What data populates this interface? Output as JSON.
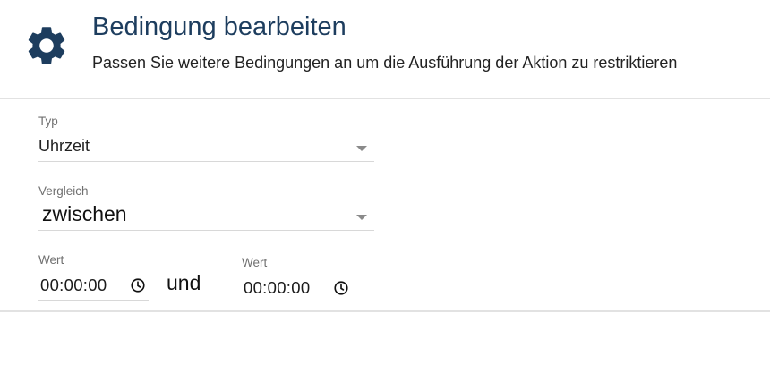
{
  "header": {
    "icon": "gear-icon",
    "title": "Bedingung bearbeiten",
    "subtitle": "Passen Sie weitere Bedingungen an um die Ausführung der Aktion zu restriktieren",
    "title_color": "#1d3d5e"
  },
  "form": {
    "typ": {
      "label": "Typ",
      "value": "Uhrzeit"
    },
    "vergleich": {
      "label": "Vergleich",
      "value": "zwischen"
    },
    "wert_from": {
      "label": "Wert",
      "value": "00:00:00",
      "icon": "clock-icon"
    },
    "connector": "und",
    "wert_to": {
      "label": "Wert",
      "value": "00:00:00",
      "icon": "clock-icon"
    }
  }
}
